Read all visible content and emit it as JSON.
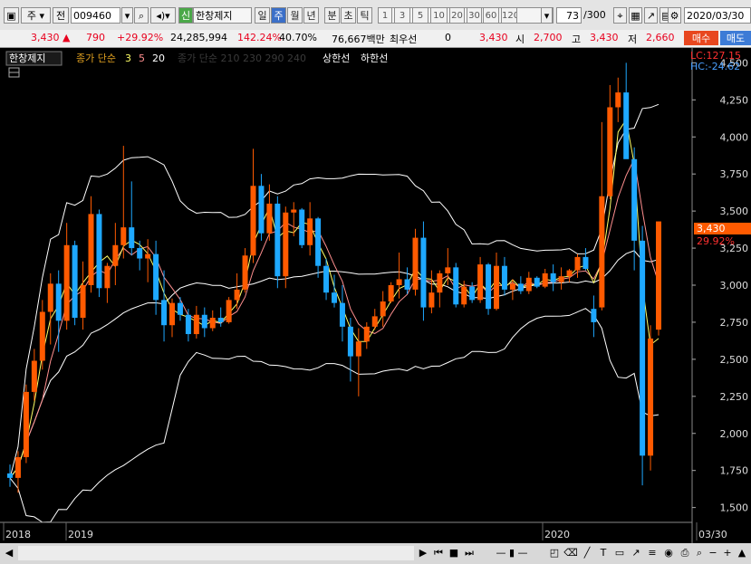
{
  "toolbar": {
    "market": "주",
    "prev_label": "전",
    "stock_code": "009460",
    "credit_badge": "신",
    "stock_name": "한창제지",
    "periods": [
      "일",
      "주",
      "월",
      "년",
      "분",
      "초",
      "틱"
    ],
    "active_period": "주",
    "intervals": [
      "1",
      "3",
      "5",
      "10",
      "20",
      "30",
      "60",
      "120"
    ],
    "view_count": "73",
    "view_total": "/300",
    "date": "2020/03/30"
  },
  "quote": {
    "price": "3,430",
    "change": "790",
    "change_pct": "+29.92%",
    "volume": "24,285,994",
    "vol_ratio": "142.24%",
    "turnover": "40.70%",
    "amount": "76,667백만",
    "preferred_label": "최우선",
    "preferred_value": "0",
    "ask": "3,430",
    "open_label": "시",
    "open": "2,700",
    "high_label": "고",
    "high": "3,430",
    "low_label": "저",
    "low": "2,660",
    "buy_label": "매수",
    "sell_label": "매도"
  },
  "legend": {
    "name": "한창제지",
    "ma_label": "종가 단순",
    "ma_periods": [
      "3",
      "5",
      "20"
    ],
    "dim_label": "종가 단순 210 230 290 240",
    "upper_label": "상한선",
    "lower_label": "하한선"
  },
  "axis": {
    "lc": "LC:127.15",
    "hc": "HC:-24.62",
    "last_price": "3,430",
    "last_pct": "29.92%",
    "date_labels": [
      "2018",
      "2019",
      "2020",
      "03/30"
    ]
  },
  "colors": {
    "up": "#ff5a00",
    "down": "#1ea8ff",
    "ma3": "#ffff66",
    "ma5": "#ff8f8f",
    "band": "#ffffff"
  },
  "chart_data": {
    "type": "candlestick",
    "x_range": [
      "2018",
      "2020/03/30"
    ],
    "y_range": [
      1400,
      4600
    ],
    "y_ticks": [
      1500,
      1750,
      2000,
      2250,
      2500,
      2750,
      3000,
      3250,
      3500,
      3750,
      4000,
      4250,
      4500
    ],
    "bars": [
      [
        1730,
        1790,
        1640,
        1700
      ],
      [
        1700,
        1880,
        1600,
        1840
      ],
      [
        1840,
        2330,
        1800,
        2280
      ],
      [
        2280,
        2570,
        2220,
        2490
      ],
      [
        2490,
        2900,
        2430,
        2820
      ],
      [
        2820,
        3080,
        2600,
        3010
      ],
      [
        3010,
        3100,
        2550,
        2760
      ],
      [
        2760,
        3420,
        2700,
        3270
      ],
      [
        3270,
        3300,
        2730,
        2780
      ],
      [
        2780,
        3160,
        2700,
        3000
      ],
      [
        3000,
        3600,
        2950,
        3480
      ],
      [
        3480,
        3510,
        2920,
        2980
      ],
      [
        2980,
        3150,
        2880,
        3130
      ],
      [
        3130,
        3420,
        3000,
        3270
      ],
      [
        3270,
        3940,
        3180,
        3390
      ],
      [
        3390,
        3700,
        3200,
        3250
      ],
      [
        3250,
        3300,
        3100,
        3180
      ],
      [
        3180,
        3310,
        3020,
        3210
      ],
      [
        3210,
        3300,
        2800,
        2900
      ],
      [
        2900,
        3100,
        2620,
        2730
      ],
      [
        2730,
        2910,
        2650,
        2880
      ],
      [
        2880,
        2920,
        2760,
        2800
      ],
      [
        2800,
        2840,
        2620,
        2670
      ],
      [
        2670,
        2860,
        2640,
        2800
      ],
      [
        2800,
        2850,
        2650,
        2710
      ],
      [
        2710,
        2830,
        2690,
        2780
      ],
      [
        2780,
        2850,
        2720,
        2750
      ],
      [
        2750,
        2920,
        2740,
        2900
      ],
      [
        2900,
        3080,
        2840,
        2970
      ],
      [
        2970,
        3250,
        2950,
        3200
      ],
      [
        3200,
        3920,
        3150,
        3670
      ],
      [
        3670,
        3750,
        3300,
        3350
      ],
      [
        3350,
        3680,
        3300,
        3550
      ],
      [
        3550,
        3600,
        2980,
        3060
      ],
      [
        3060,
        3530,
        2980,
        3490
      ],
      [
        3490,
        3560,
        3330,
        3510
      ],
      [
        3510,
        3520,
        3250,
        3270
      ],
      [
        3270,
        3560,
        3200,
        3450
      ],
      [
        3450,
        3460,
        3050,
        3130
      ],
      [
        3130,
        3180,
        2900,
        2950
      ],
      [
        2950,
        3070,
        2850,
        2880
      ],
      [
        2880,
        3000,
        2620,
        2720
      ],
      [
        2720,
        2780,
        2350,
        2520
      ],
      [
        2520,
        2710,
        2250,
        2620
      ],
      [
        2620,
        2750,
        2570,
        2720
      ],
      [
        2720,
        2840,
        2700,
        2790
      ],
      [
        2790,
        2960,
        2720,
        2890
      ],
      [
        2890,
        3020,
        2880,
        3000
      ],
      [
        3000,
        3220,
        2910,
        3040
      ],
      [
        3040,
        3120,
        2940,
        2970
      ],
      [
        2970,
        3380,
        2930,
        3320
      ],
      [
        3320,
        3430,
        2760,
        2850
      ],
      [
        2850,
        3100,
        2810,
        2950
      ],
      [
        2950,
        3100,
        2850,
        3080
      ],
      [
        3080,
        3250,
        3000,
        3120
      ],
      [
        3120,
        3150,
        2850,
        2870
      ],
      [
        2870,
        3030,
        2850,
        2990
      ],
      [
        2990,
        3020,
        2880,
        2900
      ],
      [
        2900,
        3190,
        2880,
        3140
      ],
      [
        3140,
        3150,
        2800,
        2840
      ],
      [
        2840,
        3220,
        2830,
        3130
      ],
      [
        3130,
        3190,
        2930,
        2970
      ],
      [
        2970,
        3040,
        2900,
        3010
      ],
      [
        3010,
        3060,
        2940,
        2960
      ],
      [
        2960,
        3090,
        2940,
        3050
      ],
      [
        3050,
        3060,
        2980,
        2990
      ],
      [
        2990,
        3110,
        2980,
        3080
      ],
      [
        3080,
        3140,
        2960,
        3020
      ],
      [
        3020,
        3120,
        2970,
        3060
      ],
      [
        3060,
        3110,
        3020,
        3100
      ],
      [
        3100,
        3210,
        3050,
        3190
      ],
      [
        3190,
        3250,
        3100,
        3110
      ],
      [
        2840,
        2930,
        2650,
        2750
      ],
      [
        2850,
        4100,
        2830,
        3600
      ],
      [
        3600,
        4350,
        3580,
        4200
      ],
      [
        4200,
        4400,
        4100,
        4300
      ],
      [
        4300,
        4500,
        3900,
        3850
      ],
      [
        3850,
        3930,
        3100,
        3300
      ],
      [
        3300,
        3400,
        1650,
        1850
      ],
      [
        1850,
        2730,
        1750,
        2640
      ],
      [
        2700,
        3430,
        2660,
        3430
      ]
    ]
  }
}
